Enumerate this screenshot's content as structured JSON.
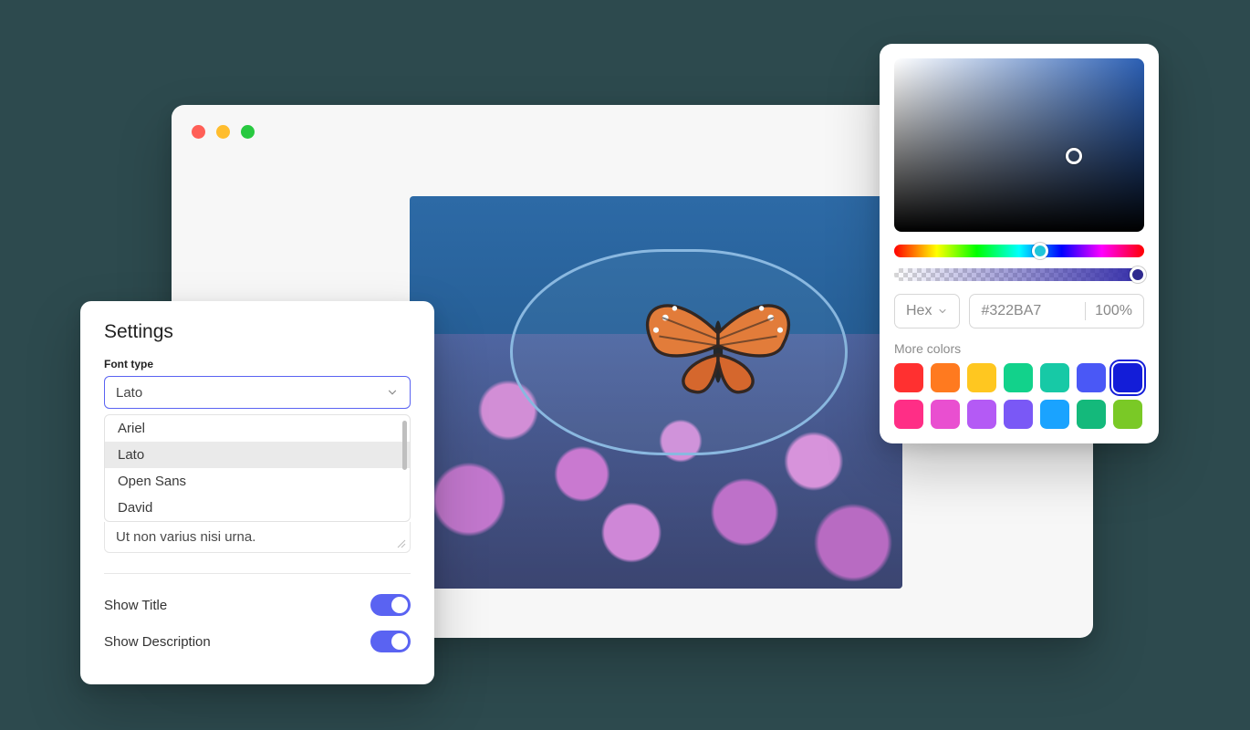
{
  "settings": {
    "title": "Settings",
    "font_label": "Font type",
    "selected_font": "Lato",
    "font_options": [
      "Ariel",
      "Lato",
      "Open Sans",
      "David"
    ],
    "selected_index": 1,
    "textarea_value": "Ut non varius nisi urna.",
    "toggles": [
      {
        "label": "Show Title",
        "on": true
      },
      {
        "label": "Show Description",
        "on": true
      }
    ]
  },
  "picker": {
    "format_label": "Hex",
    "hex_value": "#322BA7",
    "opacity": "100%",
    "more_label": "More colors",
    "swatches": [
      "#ff3030",
      "#ff7a1f",
      "#ffc720",
      "#12d28b",
      "#17c9a6",
      "#4a58f6",
      "#131dd8",
      "#ff2e86",
      "#e94fd0",
      "#b45af5",
      "#7a58f6",
      "#1aa3ff",
      "#14b97b",
      "#7ac926"
    ],
    "selected_swatch_index": 6
  },
  "image": {
    "subject": "monarch-butterfly-on-flowers",
    "highlight_shape": "ellipse"
  },
  "colors": {
    "accent": "#5a63f2",
    "panel_bg": "#ffffff",
    "page_bg": "#2d4a4e"
  }
}
